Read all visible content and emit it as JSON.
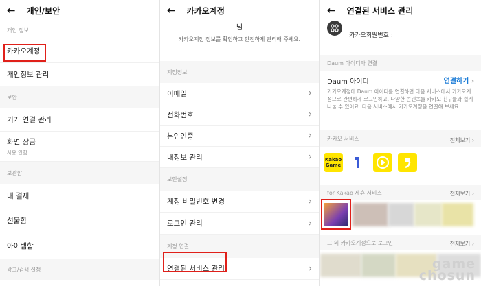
{
  "panel1": {
    "title": "개인/보안",
    "sec_personal": "개인 정보",
    "item_kakao_account": "카카오계정",
    "item_privacy": "개인정보 관리",
    "sec_security": "보안",
    "item_devices": "기기 연결 관리",
    "item_screen_lock": "화면 잠금",
    "item_screen_lock_sub": "사용 안함",
    "sec_storage": "보관함",
    "item_payment": "내 결제",
    "item_gifts": "선물함",
    "item_items": "아이템함",
    "sec_ads": "광고/검색 설정"
  },
  "panel2": {
    "title": "카카오계정",
    "name_suffix": "님",
    "intro": "카카오계정 정보를 확인하고 안전하게 관리해 주세요.",
    "sec_account": "계정정보",
    "item_email": "이메일",
    "item_phone": "전화번호",
    "item_verify": "본인인증",
    "item_myinfo": "내정보 관리",
    "sec_security": "보안설정",
    "item_password": "계정 비밀번호 변경",
    "item_login": "로그인 관리",
    "sec_link": "계정 연결",
    "item_connected": "연결된 서비스 관리"
  },
  "panel3": {
    "title": "연결된 서비스 관리",
    "member_label": "카카오회원번호 :",
    "sec_daum": "Daum 아이디와 연결",
    "daum_id": "Daum 아이디",
    "connect": "연결하기",
    "daum_desc": "카카오계정에 Daum 아이디를 연결하면 다음 서비스에서 카카오계정으로 간편하게 로그인하고, 다양한 콘텐츠를 카카오 친구들과 쉽게 나눌 수 있어요. 다음 서비스에서 카카오계정을 연결해 보세요.",
    "sec_kakao_services": "카카오 서비스",
    "view_all": "전체보기",
    "kakao_game_top": "Kakao",
    "kakao_game_bottom": "Game",
    "sec_for_kakao": "for Kakao 제휴 서비스",
    "sec_other": "그 외 카카오계정으로 로그인"
  },
  "watermark": {
    "line1": "game",
    "line2": "chosun"
  },
  "colors": {
    "highlight_red": "#e0201a",
    "kakao_yellow": "#ffe500",
    "link_blue": "#1a7bd6"
  }
}
